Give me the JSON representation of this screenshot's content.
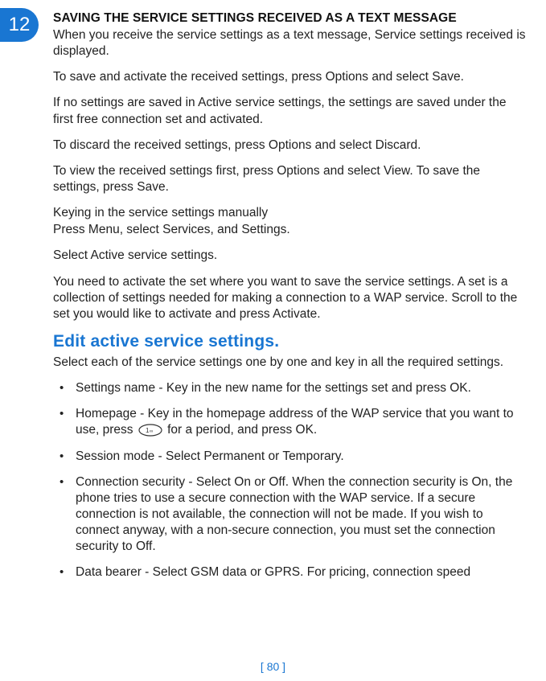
{
  "chapter_number": "12",
  "section_title": "SAVING THE SERVICE SETTINGS RECEIVED AS A TEXT MESSAGE",
  "intro_para": "When you receive the service settings as a text message, Service settings received is displayed.",
  "save_para": "To save and activate the received settings, press Options and select Save.",
  "no_settings_para": "If no settings are saved in Active service settings, the settings are saved under the first free connection set and activated.",
  "discard_para": "To discard the received settings, press Options and select Discard.",
  "view_para": "To view the received settings first, press Options and select View. To save the settings, press Save.",
  "keying_title": "Keying in the service settings manually",
  "keying_step1": "Press Menu, select Services, and Settings.",
  "keying_step2": "Select Active service settings.",
  "keying_step3": "You need to activate the set where you want to save the service settings. A set is a collection of settings needed for making a connection to a WAP service. Scroll to the set you would like to activate and press Activate.",
  "blue_heading": "Edit active service settings.",
  "blue_intro": "Select each of the service settings one by one and key in all the required settings.",
  "bullets": {
    "b1": "Settings name - Key in the new name for the settings set and press OK.",
    "b2_pre": "Homepage - Key in the homepage address of the WAP service that you want to use, press ",
    "b2_post": " for a period, and press OK.",
    "b3": "Session mode - Select Permanent or Temporary.",
    "b4": "Connection security - Select On or Off.  When the connection security is On, the phone tries to use a secure connection with the WAP service. If a secure connection is not available, the connection will not be made. If you wish to connect anyway, with a non-secure connection, you must set the connection security to Off.",
    "b5": "Data bearer - Select GSM data or GPRS. For pricing, connection speed"
  },
  "page_number": "[ 80 ]"
}
